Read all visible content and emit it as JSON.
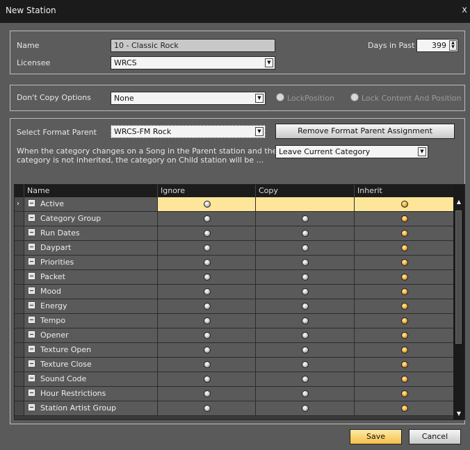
{
  "window": {
    "title": "New Station",
    "close": "x"
  },
  "station": {
    "name_label": "Name",
    "name_value": "10 - Classic Rock",
    "licensee_label": "Licensee",
    "licensee_value": "WRCS",
    "days_label": "Days in Past",
    "days_value": "399"
  },
  "copy_options": {
    "label": "Don't Copy Options",
    "value": "None",
    "lock_position": "LockPosition",
    "lock_content": "Lock Content And Position"
  },
  "format_parent": {
    "label": "Select Format Parent",
    "value": "WRCS-FM Rock",
    "remove_button": "Remove Format Parent Assignment",
    "desc_line1": "When the category changes on a Song in the Parent station and the",
    "desc_line2": "category is not inherited, the category on Child station will be ...",
    "category_value": "Leave Current Category"
  },
  "grid": {
    "columns": [
      "Name",
      "Ignore",
      "Copy",
      "Inherit"
    ],
    "rows": [
      {
        "name": "Active",
        "selected": true,
        "ignore": "gray",
        "copy": "",
        "inherit": "orange"
      },
      {
        "name": "Category Group",
        "ignore": "gray",
        "copy": "gray",
        "inherit": "orange"
      },
      {
        "name": "Run Dates",
        "ignore": "gray",
        "copy": "gray",
        "inherit": "orange"
      },
      {
        "name": "Daypart",
        "ignore": "gray",
        "copy": "gray",
        "inherit": "orange"
      },
      {
        "name": "Priorities",
        "ignore": "gray",
        "copy": "gray",
        "inherit": "orange"
      },
      {
        "name": "Packet",
        "ignore": "gray",
        "copy": "gray",
        "inherit": "orange"
      },
      {
        "name": "Mood",
        "ignore": "gray",
        "copy": "gray",
        "inherit": "orange"
      },
      {
        "name": "Energy",
        "ignore": "gray",
        "copy": "gray",
        "inherit": "orange"
      },
      {
        "name": "Tempo",
        "ignore": "gray",
        "copy": "gray",
        "inherit": "orange"
      },
      {
        "name": "Opener",
        "ignore": "gray",
        "copy": "gray",
        "inherit": "orange"
      },
      {
        "name": "Texture Open",
        "ignore": "gray",
        "copy": "gray",
        "inherit": "orange"
      },
      {
        "name": "Texture Close",
        "ignore": "gray",
        "copy": "gray",
        "inherit": "orange"
      },
      {
        "name": "Sound Code",
        "ignore": "gray",
        "copy": "gray",
        "inherit": "orange"
      },
      {
        "name": "Hour Restrictions",
        "ignore": "gray",
        "copy": "gray",
        "inherit": "orange"
      },
      {
        "name": "Station Artist Group",
        "ignore": "gray",
        "copy": "gray",
        "inherit": "orange"
      }
    ]
  },
  "footer": {
    "save": "Save",
    "cancel": "Cancel"
  },
  "colors": {
    "selected_row": "#fde69a",
    "save_button": "#f5c04a",
    "titlebar": "#1b1b1b"
  }
}
